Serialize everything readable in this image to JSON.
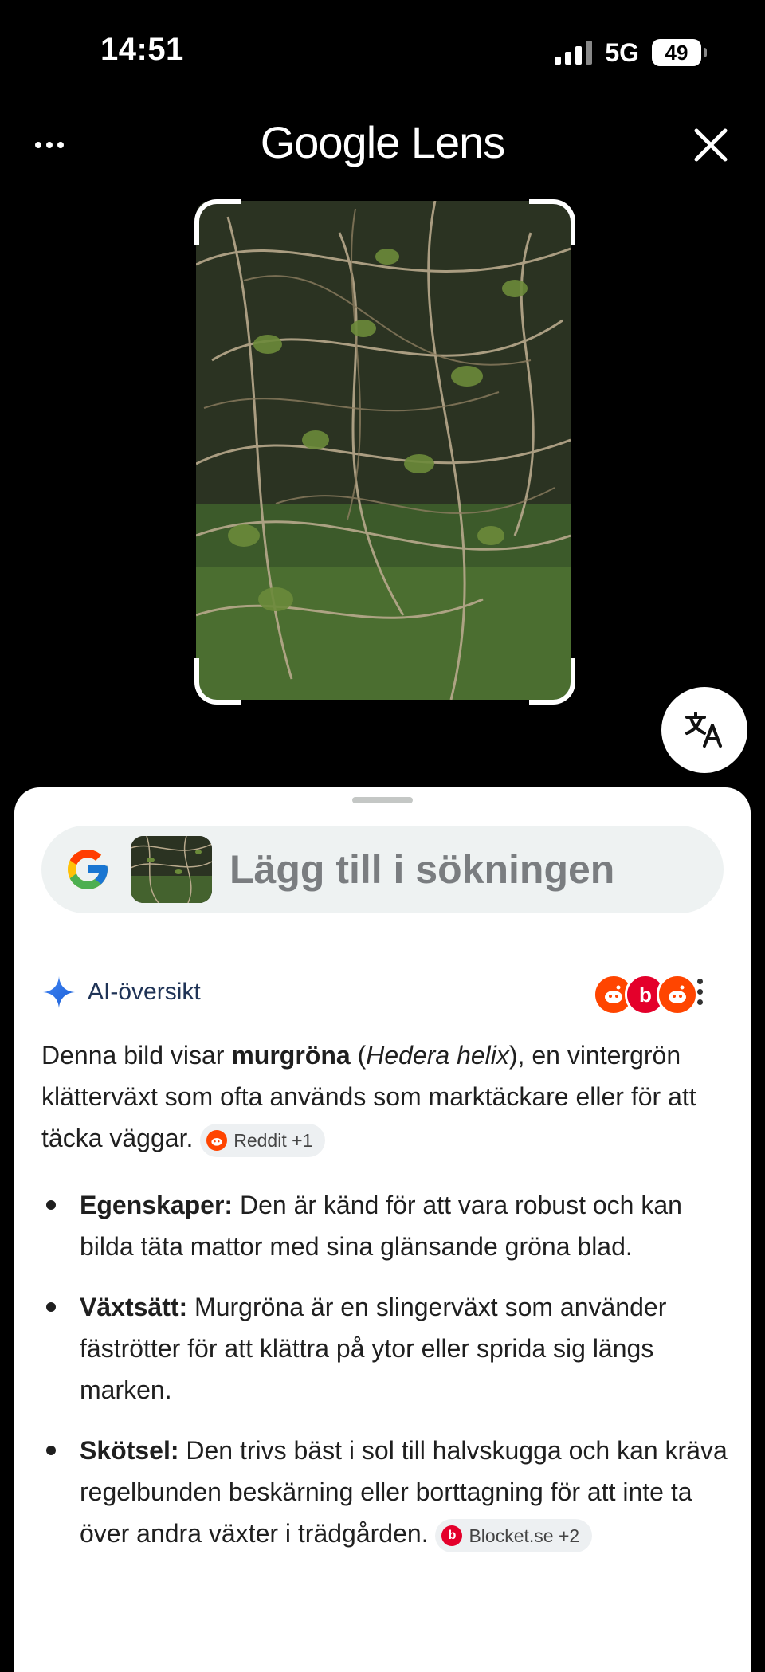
{
  "status_bar": {
    "time": "14:51",
    "network": "5G",
    "battery": "49"
  },
  "header": {
    "title": "Google Lens"
  },
  "search": {
    "placeholder": "Lägg till i sökningen"
  },
  "ai_overview": {
    "label": "AI-översikt",
    "intro": {
      "pre": "Denna bild visar ",
      "bold": "murgröna",
      "open_paren": " (",
      "italic": "Hedera helix",
      "post": "), en vintergrön klätterväxt som ofta används som marktäckare eller för att täcka väggar. "
    },
    "intro_chip": "Reddit +1",
    "source_icons": [
      "reddit-icon",
      "blocket-icon",
      "reddit-icon"
    ],
    "bullets": [
      {
        "title": "Egenskaper:",
        "text": " Den är känd för att vara robust och kan bilda täta mattor med sina glänsande gröna blad."
      },
      {
        "title": "Växtsätt:",
        "text": " Murgröna är en slingerväxt som använder fäströtter för att klättra på ytor eller sprida sig längs marken."
      },
      {
        "title": "Skötsel:",
        "text": " Den trivs bäst i sol till halvskugga och kan kräva regelbunden beskärning eller borttagning för att inte ta över andra växter i trädgården. ",
        "chip": "Blocket.se +2"
      }
    ]
  },
  "colors": {
    "reddit": "#ff4500",
    "blocket": "#e4002b",
    "accent": "#4285f4"
  }
}
